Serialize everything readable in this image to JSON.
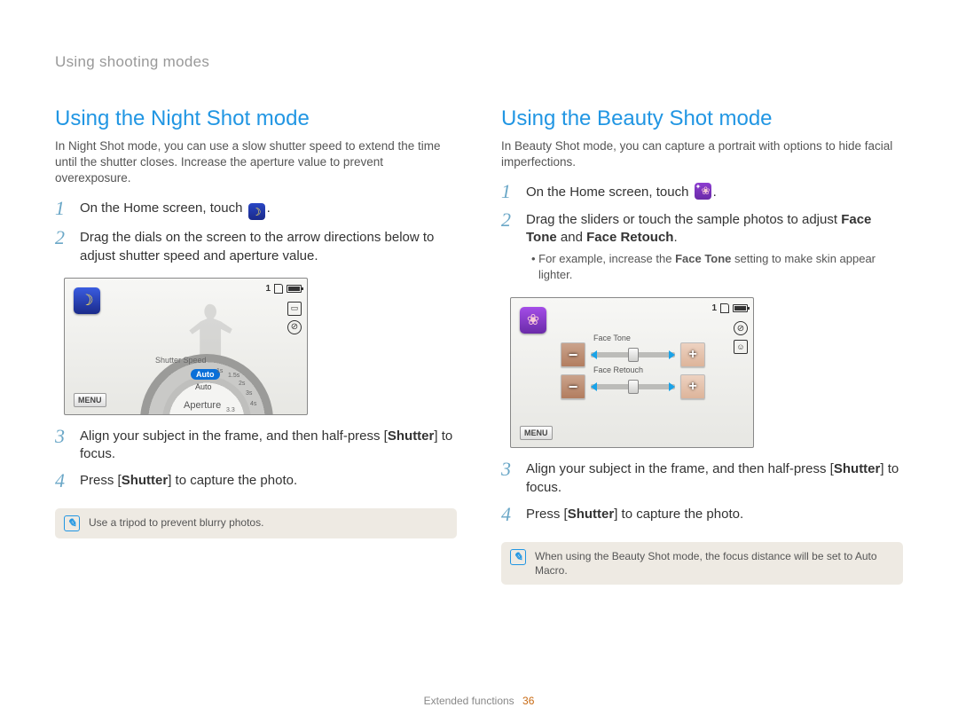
{
  "breadcrumb": "Using shooting modes",
  "footer": {
    "section": "Extended functions",
    "page": "36"
  },
  "common": {
    "menu_label": "MENU",
    "status_count": "1"
  },
  "night": {
    "title": "Using the Night Shot mode",
    "intro": "In Night Shot mode, you can use a slow shutter speed to extend the time until the shutter closes. Increase the aperture value to prevent overexposure.",
    "step1_pre": "On the Home screen, touch ",
    "step1_post": ".",
    "step2": "Drag the dials on the screen to the arrow directions below to adjust shutter speed and aperture value.",
    "step3_pre": "Align your subject in the frame, and then half-press [",
    "step3_btn": "Shutter",
    "step3_post": "] to focus.",
    "step4_pre": "Press [",
    "step4_btn": "Shutter",
    "step4_post": "] to capture the photo.",
    "dial": {
      "shutter_label": "Shutter Speed",
      "aperture_label": "Aperture",
      "auto_pill": "Auto",
      "auto_text": "Auto",
      "ticks": [
        "1s",
        "1.5s",
        "2s",
        "3s",
        "4s",
        "3.3"
      ]
    },
    "note": "Use a tripod to prevent blurry photos."
  },
  "beauty": {
    "title": "Using the Beauty Shot mode",
    "intro": "In Beauty Shot mode, you can capture a portrait with options to hide facial imperfections.",
    "step1_pre": "On the Home screen, touch ",
    "step1_post": ".",
    "step2_pre": "Drag the sliders or touch the sample photos to adjust ",
    "step2_b1": "Face Tone",
    "step2_and": " and ",
    "step2_b2": "Face Retouch",
    "step2_post": ".",
    "sub_pre": "For example, increase the ",
    "sub_bold": "Face Tone",
    "sub_post": " setting to make skin appear lighter.",
    "slider1_label": "Face Tone",
    "slider2_label": "Face Retouch",
    "step3_pre": "Align your subject in the frame, and then half-press [",
    "step3_btn": "Shutter",
    "step3_post": "] to focus.",
    "step4_pre": "Press [",
    "step4_btn": "Shutter",
    "step4_post": "] to capture the photo.",
    "note": "When using the Beauty Shot mode, the focus distance will be set to Auto Macro."
  }
}
